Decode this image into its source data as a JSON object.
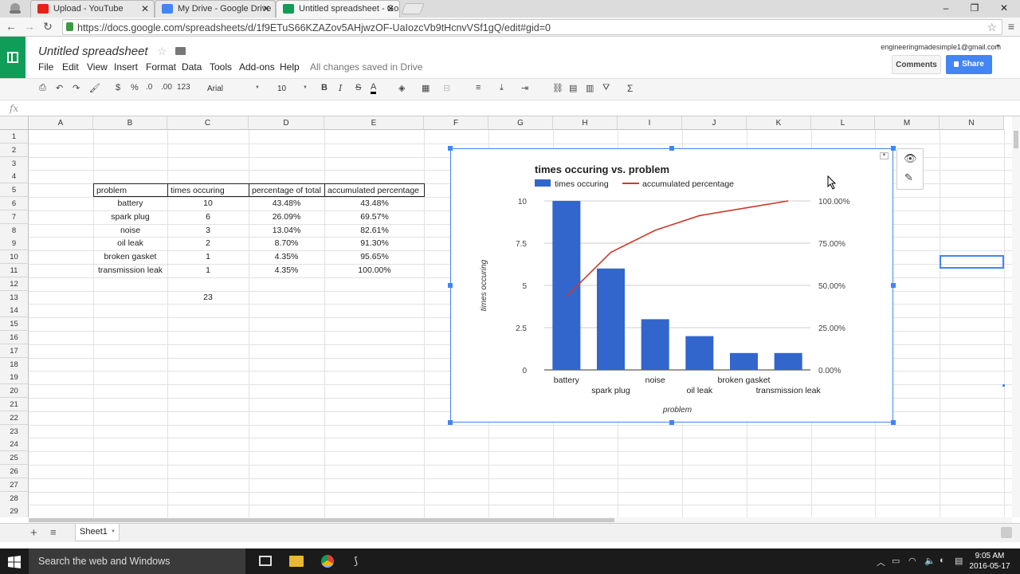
{
  "browser": {
    "tabs": [
      {
        "label": "Upload - YouTube",
        "favicon_color": "#e62117"
      },
      {
        "label": "My Drive - Google Drive",
        "favicon_color": "#4285f4"
      },
      {
        "label": "Untitled spreadsheet - Go",
        "favicon_color": "#0f9d58"
      }
    ],
    "url": "https://docs.google.com/spreadsheets/d/1f9ETuS66KZAZov5AHjwzOF-UaIozcVb9tHcnvVSf1gQ/edit#gid=0"
  },
  "doc": {
    "title": "Untitled spreadsheet",
    "menu": [
      "File",
      "Edit",
      "View",
      "Insert",
      "Format",
      "Data",
      "Tools",
      "Add-ons",
      "Help"
    ],
    "save_status": "All changes saved in Drive",
    "account": "engineeringmadesimple1@gmail.com",
    "comments_label": "Comments",
    "share_label": "Share",
    "accent": "#0f9d58"
  },
  "toolbar": {
    "currency": "$",
    "percent": "%",
    "dec_less": ".0",
    "dec_more": ".00",
    "more_formats": "123",
    "font": "Arial",
    "size": "10",
    "bold": "B",
    "italic": "I",
    "strike": "S",
    "text_color": "A",
    "functions": "Σ"
  },
  "formula": {
    "label": "fx",
    "value": ""
  },
  "grid": {
    "columns": [
      "A",
      "B",
      "C",
      "D",
      "E",
      "F",
      "G",
      "H",
      "I",
      "J",
      "K",
      "L",
      "M",
      "N"
    ],
    "rows": [
      "1",
      "2",
      "3",
      "4",
      "5",
      "6",
      "7",
      "8",
      "9",
      "10",
      "11",
      "12",
      "13",
      "14",
      "15",
      "16",
      "17",
      "18",
      "19",
      "20",
      "21",
      "22",
      "23",
      "24",
      "25",
      "26",
      "27",
      "28",
      "29"
    ],
    "table": {
      "headers": [
        "problem",
        "times occuring",
        "percentage of total",
        "accumulated percentage"
      ],
      "rows": [
        [
          "battery",
          "10",
          "43.48%",
          "43.48%"
        ],
        [
          "spark plug",
          "6",
          "26.09%",
          "69.57%"
        ],
        [
          "noise",
          "3",
          "13.04%",
          "82.61%"
        ],
        [
          "oil leak",
          "2",
          "8.70%",
          "91.30%"
        ],
        [
          "broken gasket",
          "1",
          "4.35%",
          "95.65%"
        ],
        [
          "transmission leak",
          "1",
          "4.35%",
          "100.00%"
        ]
      ],
      "total": "23"
    }
  },
  "chart_data": {
    "type": "bar",
    "title": "times occuring vs. problem",
    "categories": [
      "battery",
      "spark plug",
      "noise",
      "oil leak",
      "broken gasket",
      "transmission leak"
    ],
    "series": [
      {
        "name": "times occuring",
        "type": "bar",
        "values": [
          10,
          6,
          3,
          2,
          1,
          1
        ],
        "color": "#3366cc",
        "axis": "left"
      },
      {
        "name": "accumulated percentage",
        "type": "line",
        "values": [
          43.48,
          69.57,
          82.61,
          91.3,
          95.65,
          100.0
        ],
        "color": "#cc3a2a",
        "axis": "right"
      }
    ],
    "xlabel": "problem",
    "ylabel": "times occuring",
    "ylim": [
      0,
      10
    ],
    "yticks": [
      "0",
      "2.5",
      "5",
      "7.5",
      "10"
    ],
    "y2lim": [
      0,
      100
    ],
    "y2ticks": [
      "0.00%",
      "25.00%",
      "50.00%",
      "75.00%",
      "100.00%"
    ],
    "legend": "top"
  },
  "sheets": {
    "active": "Sheet1"
  },
  "taskbar": {
    "search_placeholder": "Search the web and Windows",
    "time": "9:05 AM",
    "date": "2016-05-17"
  }
}
